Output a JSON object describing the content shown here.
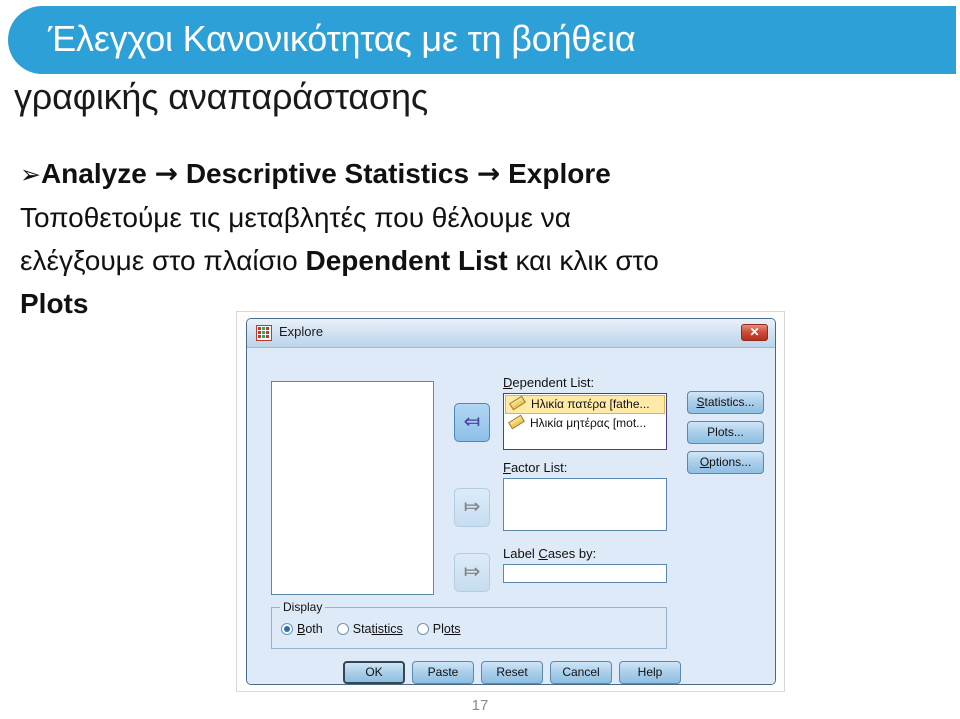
{
  "slide": {
    "title_line1": "Έλεγχοι Κανονικότητας με τη βοήθεια",
    "title_line2": "γραφικής αναπαράστασης",
    "banner_color": "#2ca0d7",
    "bullet_glyph": "➢",
    "arrow_glyph": "→",
    "body": {
      "menu_path_1": "Analyze",
      "menu_path_2": "Descriptive Statistics",
      "menu_path_3": "Explore",
      "text_1": "Τοποθετούμε τις μεταβλητές που θέλουμε να",
      "text_2": "ελέγξουμε στο πλαίσιο",
      "emphasis_1": "Dependent List",
      "text_3": "και κλικ στο",
      "emphasis_2": "Plots"
    },
    "page_number": "17"
  },
  "dialog": {
    "title": "Explore",
    "title_icon": "spss-variable-grid-icon",
    "close_label": "✕",
    "source_list": {
      "name": "source-variables",
      "items": []
    },
    "transfer_buttons": [
      {
        "name": "move-to-dependent-list",
        "glyph": "➡",
        "state": "enabled",
        "direction": "left"
      },
      {
        "name": "move-to-factor-list",
        "glyph": "➡",
        "state": "disabled",
        "direction": "right"
      },
      {
        "name": "move-to-label-cases",
        "glyph": "➡",
        "state": "disabled",
        "direction": "right"
      }
    ],
    "dependent_list": {
      "label_pre": "D",
      "label_post": "ependent List:",
      "items": [
        {
          "text": "Ηλικία πατέρα [fathe...",
          "icon": "ruler-scale-icon",
          "selected": true
        },
        {
          "text": "Ηλικία μητέρας [mot...",
          "icon": "ruler-scale-icon",
          "selected": false
        }
      ]
    },
    "factor_list": {
      "label_pre": "F",
      "label_post": "actor List:",
      "value": ""
    },
    "label_cases": {
      "label_pre": "Label ",
      "label_mid": "C",
      "label_post": "ases by:",
      "value": ""
    },
    "side_buttons": [
      {
        "pre": "S",
        "mid": "",
        "post": "tatistics...",
        "name": "statistics-button"
      },
      {
        "pre": "",
        "mid": "",
        "post": "Plots...",
        "name": "plots-button"
      },
      {
        "pre": "O",
        "mid": "",
        "post": "ptions...",
        "name": "options-button"
      }
    ],
    "display_group": {
      "caption": "Display",
      "options": [
        {
          "pre": "B",
          "post": "oth",
          "selected": true
        },
        {
          "pre": "Sta",
          "post": "tistics",
          "selected": false
        },
        {
          "pre": "Pl",
          "post": "ots",
          "selected": false
        }
      ]
    },
    "action_buttons": [
      {
        "label": "OK",
        "name": "ok-button",
        "default": true
      },
      {
        "label": "Paste",
        "name": "paste-button",
        "default": false
      },
      {
        "label": "Reset",
        "name": "reset-button",
        "default": false
      },
      {
        "label": "Cancel",
        "name": "cancel-button",
        "default": false
      },
      {
        "label": "Help",
        "name": "help-button",
        "default": false
      }
    ]
  }
}
